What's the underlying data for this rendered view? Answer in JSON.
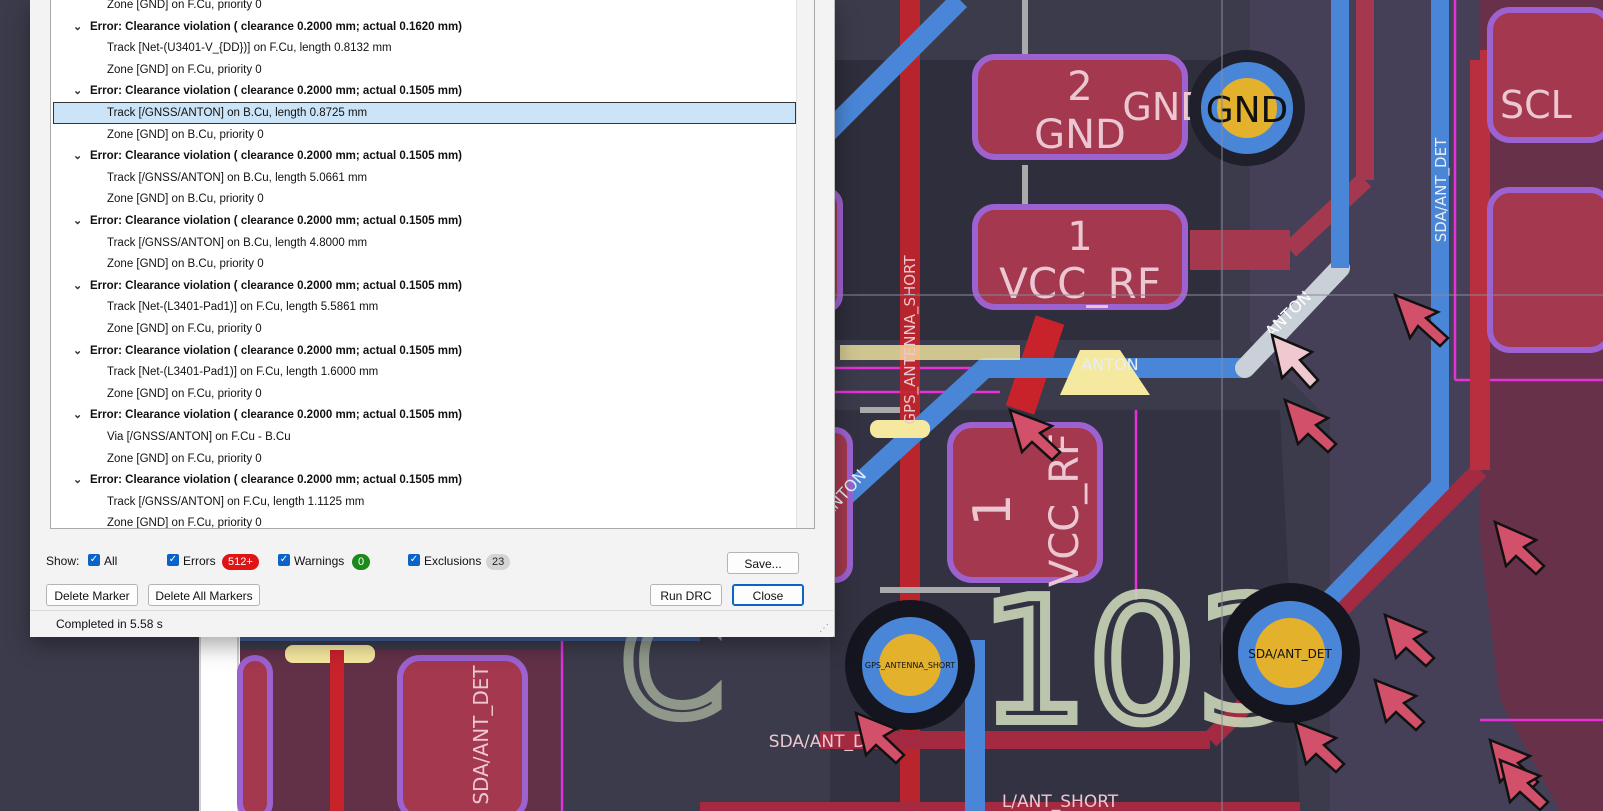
{
  "violations": [
    {
      "kind": "item",
      "text": "Zone [GND] on F.Cu, priority 0"
    },
    {
      "kind": "error",
      "text": "Error: Clearance violation ( clearance 0.2000 mm; actual 0.1620 mm)"
    },
    {
      "kind": "item",
      "text": "Track [Net-(U3401-V_{DD})] on F.Cu, length 0.8132 mm"
    },
    {
      "kind": "item",
      "text": "Zone [GND] on F.Cu, priority 0"
    },
    {
      "kind": "error",
      "text": "Error: Clearance violation ( clearance 0.2000 mm; actual 0.1505 mm)"
    },
    {
      "kind": "item",
      "text": "Track [/GNSS/ANTON] on B.Cu, length 0.8725 mm",
      "selected": true
    },
    {
      "kind": "item",
      "text": "Zone [GND] on B.Cu, priority 0"
    },
    {
      "kind": "error",
      "text": "Error: Clearance violation ( clearance 0.2000 mm; actual 0.1505 mm)"
    },
    {
      "kind": "item",
      "text": "Track [/GNSS/ANTON] on B.Cu, length 5.0661 mm"
    },
    {
      "kind": "item",
      "text": "Zone [GND] on B.Cu, priority 0"
    },
    {
      "kind": "error",
      "text": "Error: Clearance violation ( clearance 0.2000 mm; actual 0.1505 mm)"
    },
    {
      "kind": "item",
      "text": "Track [/GNSS/ANTON] on B.Cu, length 4.8000 mm"
    },
    {
      "kind": "item",
      "text": "Zone [GND] on B.Cu, priority 0"
    },
    {
      "kind": "error",
      "text": "Error: Clearance violation ( clearance 0.2000 mm; actual 0.1505 mm)"
    },
    {
      "kind": "item",
      "text": "Track [Net-(L3401-Pad1)] on F.Cu, length 5.5861 mm"
    },
    {
      "kind": "item",
      "text": "Zone [GND] on F.Cu, priority 0"
    },
    {
      "kind": "error",
      "text": "Error: Clearance violation ( clearance 0.2000 mm; actual 0.1505 mm)"
    },
    {
      "kind": "item",
      "text": "Track [Net-(L3401-Pad1)] on F.Cu, length 1.6000 mm"
    },
    {
      "kind": "item",
      "text": "Zone [GND] on F.Cu, priority 0"
    },
    {
      "kind": "error",
      "text": "Error: Clearance violation ( clearance 0.2000 mm; actual 0.1505 mm)"
    },
    {
      "kind": "item",
      "text": "Via [/GNSS/ANTON] on F.Cu - B.Cu"
    },
    {
      "kind": "item",
      "text": "Zone [GND] on F.Cu, priority 0"
    },
    {
      "kind": "error",
      "text": "Error: Clearance violation ( clearance 0.2000 mm; actual 0.1505 mm)"
    },
    {
      "kind": "item",
      "text": "Track [/GNSS/ANTON] on F.Cu, length 1.1125 mm"
    },
    {
      "kind": "item",
      "text": "Zone [GND] on F.Cu, priority 0"
    }
  ],
  "filters": {
    "show_label": "Show:",
    "all_label": "All",
    "errors_label": "Errors",
    "errors_count": "512+",
    "warnings_label": "Warnings",
    "warnings_count": "0",
    "exclusions_label": "Exclusions",
    "exclusions_count": "23"
  },
  "buttons": {
    "save": "Save...",
    "delete_marker": "Delete Marker",
    "delete_all_markers": "Delete All Markers",
    "run_drc": "Run DRC",
    "close": "Close"
  },
  "status": {
    "text": "Completed in 5.58 s"
  },
  "pcb": {
    "pad_2_number": "2",
    "pad_2_net": "GND",
    "pad_1_number": "1",
    "pad_1_net": "VCC_RF",
    "pad_lower_number": "1",
    "pad_lower_net": "VCC_RF",
    "via_gnd_label": "GND",
    "via_gnd_net_label": "GND",
    "via_gps_label": "GPS_ANTENNA_SHORT",
    "via_sda_label": "SDA/ANT_DET",
    "track_anton_label": "ANTON",
    "track_anton_diag_label": "ANTON",
    "track_anton_left_label": "ANTON",
    "track_anton_bottom_label": "ANTON",
    "track_gps_short_label": "GPS_ANTENNA_SHORT",
    "track_sda_right_label": "SDA/ANT_DET",
    "track_sda_bottom_label": "SDA/ANT_DET",
    "track_ant_short_bottom_label": "L/ANT_SHORT",
    "scl_label": "SCL",
    "silk_ref": "103",
    "colors": {
      "board": "#3a3a4a",
      "front_copper": "#c8232b",
      "back_copper": "#4a86d8",
      "pad": "#a3384f",
      "pad_outline": "#9d62d0",
      "silkscreen": "#c9d6b8",
      "edge_magenta": "#e830d8",
      "via_ring": "#f0c030"
    }
  }
}
